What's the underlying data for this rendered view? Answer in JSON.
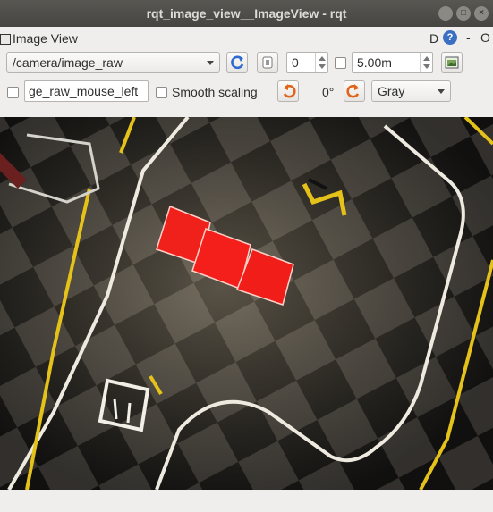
{
  "window": {
    "title": "rqt_image_view__ImageView - rqt"
  },
  "panel": {
    "title": "Image View",
    "d_label": "D",
    "help_label": "?",
    "dash_label": "-",
    "close_label": "O"
  },
  "toolbar": {
    "topic": "/camera/image_raw",
    "spin_value": "0",
    "max_value": "5.00m",
    "mouse_topic": "ge_raw_mouse_left",
    "smooth_scaling_label": "Smooth scaling",
    "rotation": "0°",
    "color_scheme": "Gray"
  },
  "colors": {
    "accent_blue": "#3b6fc4",
    "rotate_orange": "#e0641a",
    "titlebar": "#4f4e4a"
  },
  "icons": [
    "refresh-icon",
    "zoom-icon",
    "save-icon",
    "rotate-left-icon",
    "rotate-right-icon",
    "help-icon"
  ]
}
